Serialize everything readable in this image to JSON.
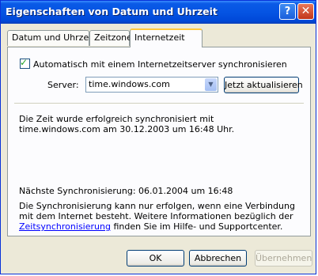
{
  "window": {
    "title": "Eigenschaften von Datum und Uhrzeit",
    "help_glyph": "?",
    "close_glyph": "✕"
  },
  "tabs": [
    {
      "label": "Datum und Uhrzeit",
      "active": false
    },
    {
      "label": "Zeitzone",
      "active": false
    },
    {
      "label": "Internetzeit",
      "active": true
    }
  ],
  "internet_time": {
    "auto_sync_label": "Automatisch mit einem Internetzeitserver synchronisieren",
    "auto_sync_checked": true,
    "server_label": "Server:",
    "server_value": "time.windows.com",
    "update_button": "Jetzt aktualisieren",
    "status_message": "Die Zeit wurde erfolgreich synchronisiert mit time.windows.com am 30.12.2003 um 16:48 Uhr.",
    "next_sync": "Nächste Synchronisierung: 06.01.2004 um 16:48",
    "info_text_before": "Die Synchronisierung kann nur erfolgen, wenn eine Verbindung mit dem Internet besteht. Weitere Informationen bezüglich der ",
    "info_link": "Zeitsynchronisierung",
    "info_text_after": " finden Sie im Hilfe- und Supportcenter."
  },
  "buttons": {
    "ok": "OK",
    "cancel": "Abbrechen",
    "apply": "Übernehmen"
  }
}
